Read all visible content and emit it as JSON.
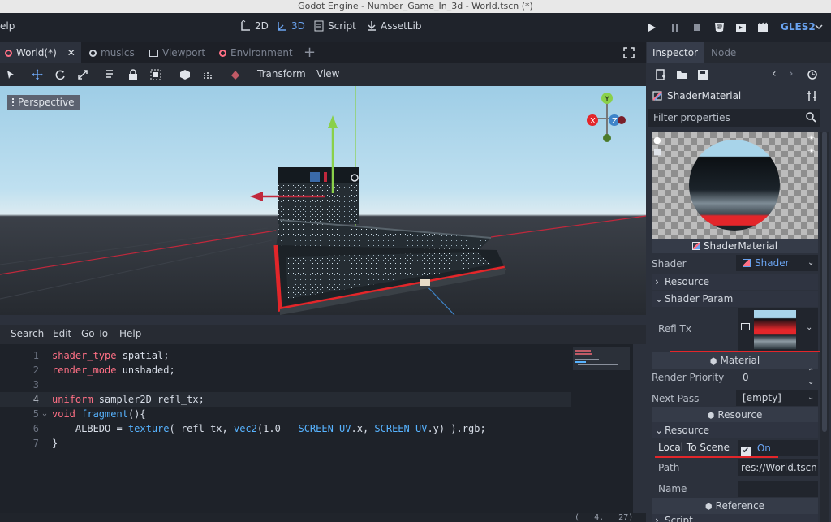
{
  "window": {
    "title": "Godot Engine - Number_Game_In_3d - World.tscn (*)"
  },
  "menubar": {
    "help": "elp"
  },
  "workspaces": {
    "w2d": "2D",
    "w3d": "3D",
    "script": "Script",
    "assetlib": "AssetLib"
  },
  "renderer": "GLES2",
  "scene_tabs": [
    {
      "label": "World(*)"
    },
    {
      "label": "musics"
    },
    {
      "label": "Viewport"
    },
    {
      "label": "Environment"
    }
  ],
  "toolbar3d": {
    "transform": "Transform",
    "view": "View"
  },
  "viewport": {
    "mode": "Perspective",
    "gizmo": {
      "x": "X",
      "y": "Y",
      "z": "Z"
    }
  },
  "script_menu": {
    "search": "Search",
    "edit": "Edit",
    "goto": "Go To",
    "help": "Help"
  },
  "code": {
    "lines": [
      "1",
      "2",
      "3",
      "4",
      "5",
      "6",
      "7"
    ],
    "l1a": "shader_type",
    " l1b": "",
    "line1_kw": "shader_type",
    "line1_rest": " spatial;",
    "line2_kw": "render_mode",
    "line2_rest": " unshaded;",
    "line4_kw": "uniform",
    "line4_rest": " sampler2D refl_tx;",
    "line5_kw": "void",
    "line5_fn": " fragment",
    "line5_rest": "(){",
    "line6_a": "    ALBEDO = ",
    "line6_fn1": "texture",
    "line6_b": "( refl_tx, ",
    "line6_fn2": "vec2",
    "line6_c": "(1.0 - ",
    "line6_fn3": "SCREEN_UV",
    "line6_d": ".x, ",
    "line6_fn4": "SCREEN_UV",
    "line6_e": ".y) ).rgb;",
    "line7": "}"
  },
  "status": {
    "cursor": "(   4,   27)"
  },
  "inspector": {
    "tabs": {
      "inspector": "Inspector",
      "node": "Node"
    },
    "resource_name": "ShaderMaterial",
    "filter_placeholder": "Filter properties",
    "preview_label": "ShaderMaterial",
    "shader_label": "Shader",
    "shader_value": "Shader",
    "resource_section": "Resource",
    "shader_param_section": "Shader Param",
    "refl_tx_label": "Refl Tx",
    "material_section": "Material",
    "render_priority_label": "Render Priority",
    "render_priority_value": "0",
    "next_pass_label": "Next Pass",
    "next_pass_value": "[empty]",
    "resource_header": "Resource",
    "resource_sub": "Resource",
    "local_to_scene_label": "Local To Scene",
    "local_to_scene_value": "On",
    "path_label": "Path",
    "path_value": "res://World.tscn::",
    "name_label": "Name",
    "reference_section": "Reference",
    "script_sub": "Script"
  },
  "colors": {
    "accent": "#699ce8",
    "red": "#e3262a",
    "kw": "#ff7085",
    "fn": "#57b3ff"
  }
}
